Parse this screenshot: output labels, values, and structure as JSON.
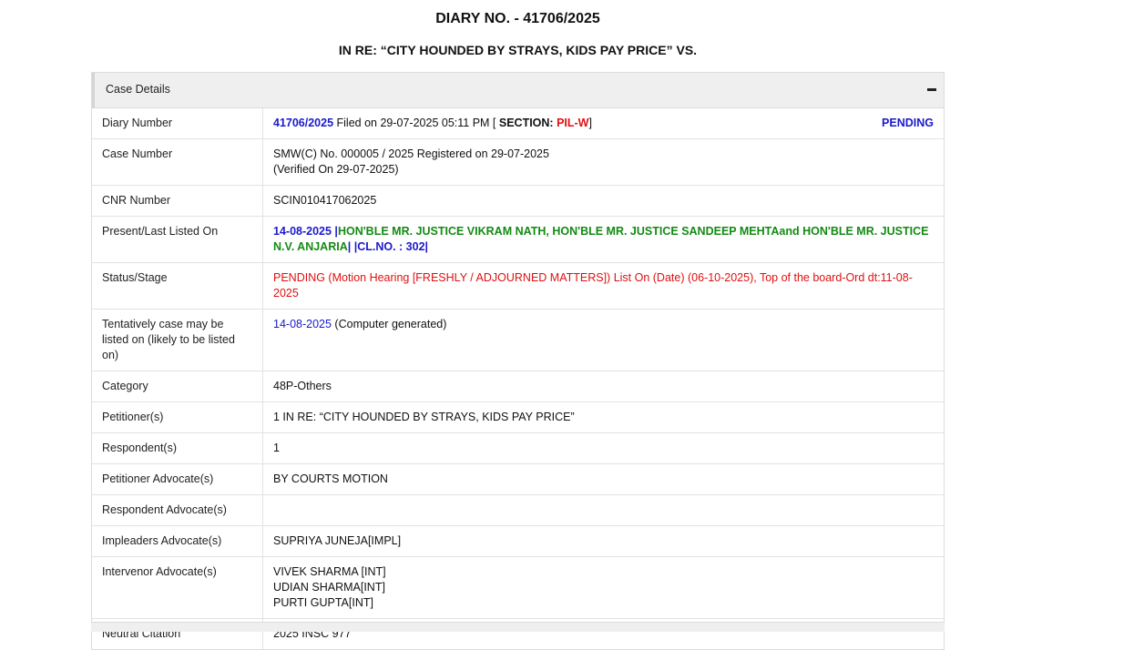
{
  "header": {
    "title": "DIARY NO. - 41706/2025",
    "subtitle": "IN RE: “CITY HOUNDED BY STRAYS, KIDS PAY PRICE” VS."
  },
  "panel": {
    "title": "Case Details",
    "collapse_icon": "minus-icon"
  },
  "rows": {
    "diary": {
      "label": "Diary Number",
      "number": "41706/2025",
      "filed": " Filed on 29-07-2025 05:11 PM [ ",
      "section_label": "SECTION: ",
      "section": "PIL-W",
      "close": "]",
      "status": "PENDING"
    },
    "case_number": {
      "label": "Case Number",
      "line1": "SMW(C) No. 000005 / 2025 Registered on 29-07-2025",
      "line2": "(Verified On 29-07-2025)"
    },
    "cnr": {
      "label": "CNR Number",
      "value": "SCIN010417062025"
    },
    "listed": {
      "label": "Present/Last Listed On",
      "date": "14-08-2025",
      "sep1": " |",
      "judges": "HON'BLE MR. JUSTICE VIKRAM NATH, HON'BLE MR. JUSTICE SANDEEP MEHTAand HON'BLE MR. JUSTICE N.V. ANJARIA",
      "sep2": "| ",
      "clno": "|CL.NO. : 302|"
    },
    "status": {
      "label": "Status/Stage",
      "value": "PENDING (Motion Hearing [FRESHLY / ADJOURNED MATTERS]) List On (Date) (06-10-2025), Top of the board-Ord dt:11-08-2025"
    },
    "tentative": {
      "label": "Tentatively case may be listed on (likely to be listed on)",
      "date": "14-08-2025",
      "note": " (Computer generated)"
    },
    "category": {
      "label": "Category",
      "value": "48P-Others"
    },
    "petitioner": {
      "label": "Petitioner(s)",
      "value": "1 IN RE: “CITY HOUNDED BY STRAYS, KIDS PAY PRICE”"
    },
    "respondent": {
      "label": "Respondent(s)",
      "value": "1"
    },
    "pet_adv": {
      "label": "Petitioner Advocate(s)",
      "value": "BY COURTS MOTION"
    },
    "res_adv": {
      "label": "Respondent Advocate(s)",
      "value": ""
    },
    "imp_adv": {
      "label": "Impleaders Advocate(s)",
      "value": "SUPRIYA JUNEJA[IMPL]"
    },
    "int_adv": {
      "label": "Intervenor Advocate(s)",
      "values": [
        "VIVEK SHARMA [INT]",
        "UDIAN SHARMA[INT]",
        "PURTI GUPTA[INT]"
      ]
    },
    "citation": {
      "label": "Neutral Citation",
      "value": "2025 INSC 977"
    }
  },
  "colors": {
    "blue": "#1a1acc",
    "red": "#e01010",
    "green": "#138a13"
  }
}
